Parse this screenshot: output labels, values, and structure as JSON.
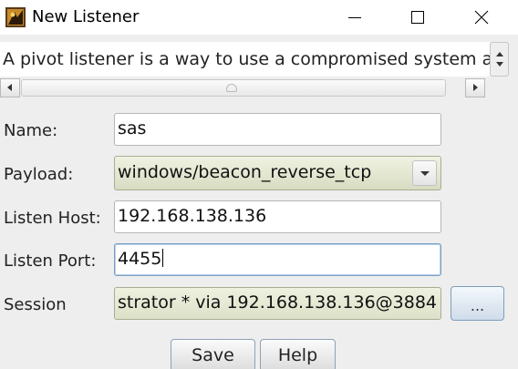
{
  "window": {
    "title": "New Listener",
    "controls": {
      "minimize": "minimize-icon",
      "maximize": "maximize-icon",
      "close": "close-icon"
    }
  },
  "description": "A pivot listener is a way to use a compromised system as",
  "form": {
    "name": {
      "label": "Name:",
      "value": "sas"
    },
    "payload": {
      "label": "Payload:",
      "value": "windows/beacon_reverse_tcp"
    },
    "listen_host": {
      "label": "Listen Host:",
      "value": "192.168.138.136"
    },
    "listen_port": {
      "label": "Listen Port:",
      "value": "4455"
    },
    "session": {
      "label": "Session",
      "value": "strator * via  192.168.138.136@3884",
      "browse_label": "..."
    }
  },
  "buttons": {
    "save": "Save",
    "help": "Help"
  },
  "colors": {
    "combo_bg": "#e3e6cf",
    "button_border": "#8da2b9"
  }
}
